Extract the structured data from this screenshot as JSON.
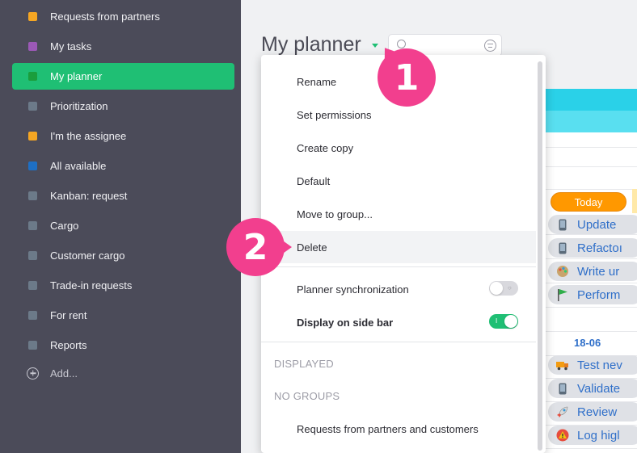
{
  "sidebar": {
    "items": [
      {
        "label": "Requests from partners",
        "color": "#f5a623"
      },
      {
        "label": "My tasks",
        "color": "#9b59b6"
      },
      {
        "label": "My planner",
        "color": "#1a9e3c",
        "active": true
      },
      {
        "label": "Prioritization",
        "color": "#6c7a89"
      },
      {
        "label": "I'm the assignee",
        "color": "#f5a623"
      },
      {
        "label": "All available",
        "color": "#1e6fc4"
      },
      {
        "label": "Kanban: request",
        "color": "#6c7a89"
      },
      {
        "label": "Cargo",
        "color": "#6c7a89"
      },
      {
        "label": "Customer cargo",
        "color": "#6c7a89"
      },
      {
        "label": "Trade-in requests",
        "color": "#6c7a89"
      },
      {
        "label": "For rent",
        "color": "#6c7a89"
      },
      {
        "label": "Reports",
        "color": "#6c7a89"
      }
    ],
    "add_label": "Add..."
  },
  "header": {
    "title": "My planner"
  },
  "board": {
    "today_label": "Today",
    "date_label": "18-06",
    "tasks": [
      {
        "label": "Update",
        "icon": "phone-icon"
      },
      {
        "label": "Refactoı",
        "icon": "phone-icon"
      },
      {
        "label": "Write ur",
        "icon": "palette-icon"
      },
      {
        "label": "Perform",
        "icon": "flag-icon"
      },
      {
        "label": "Test nev",
        "icon": "truck-icon"
      },
      {
        "label": "Validate",
        "icon": "phone-icon"
      },
      {
        "label": "Review",
        "icon": "rocket-icon"
      },
      {
        "label": "Log higl",
        "icon": "warning-icon"
      }
    ]
  },
  "menu": {
    "items": [
      "Rename",
      "Set permissions",
      "Create copy",
      "Default",
      "Move to group...",
      "Delete"
    ],
    "sync_label": "Planner synchronization",
    "sync_on": false,
    "sidebar_label": "Display on side bar",
    "sidebar_on": true,
    "section_displayed": "DISPLAYED",
    "section_no_groups": "NO GROUPS",
    "group_item": "Requests from partners and customers"
  },
  "callouts": {
    "one": "1",
    "two": "2"
  },
  "colors": {
    "accent": "#1fbf74",
    "sidebar_bg": "#4b4b59",
    "badge": "#f23f8e",
    "today": "#ff9800",
    "task_text": "#2f6fc9"
  }
}
